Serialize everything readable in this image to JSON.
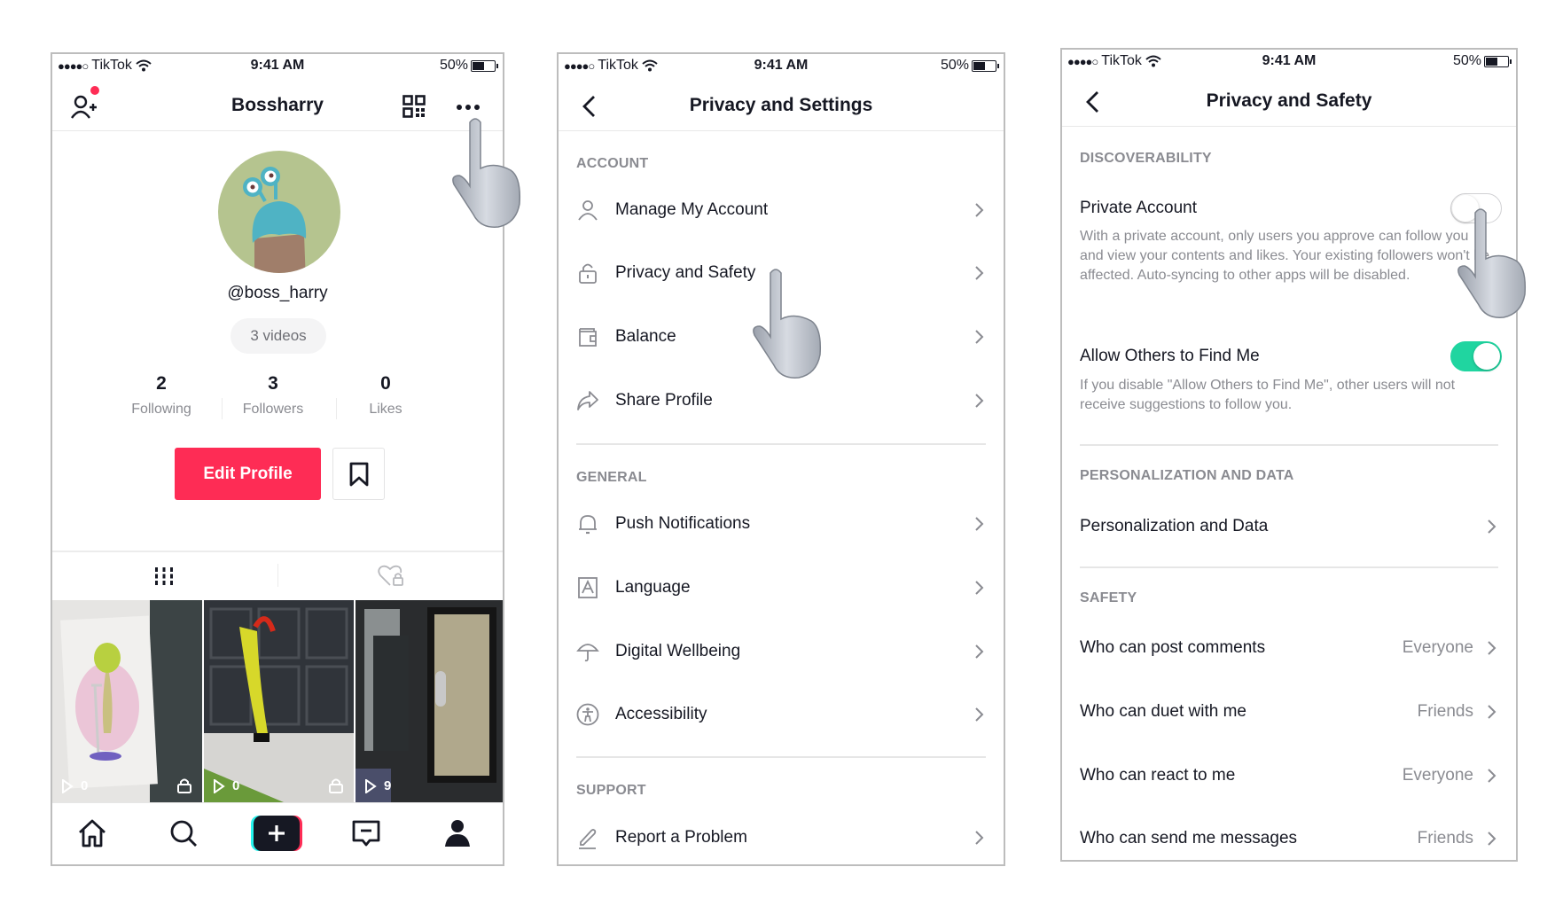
{
  "status_bar": {
    "signal_dots": "●●●●○",
    "carrier": "TikTok",
    "time": "9:41 AM",
    "battery_percent_label": "50%",
    "battery_level": 0.5
  },
  "profile_screen": {
    "title": "Bossharry",
    "has_notification_dot": true,
    "notification_color": "#fe2c55",
    "username": "@boss_harry",
    "videos_pill": "3 videos",
    "stats": [
      {
        "value": "2",
        "label": "Following"
      },
      {
        "value": "3",
        "label": "Followers"
      },
      {
        "value": "0",
        "label": "Likes"
      }
    ],
    "edit_profile_label": "Edit Profile",
    "accent_color": "#fe2c55",
    "tabs": [
      {
        "icon": "grid-icon",
        "active": true
      },
      {
        "icon": "liked-private-icon",
        "active": false
      }
    ],
    "videos": [
      {
        "views": "0",
        "private": true,
        "subject": "alien on scooter"
      },
      {
        "views": "0",
        "private": true,
        "subject": "inflatable tube man"
      },
      {
        "views": "9",
        "private": false,
        "subject": "person at glass door"
      }
    ],
    "bottom_nav": [
      "home-icon",
      "discover-icon",
      "create-icon",
      "inbox-icon",
      "profile-icon"
    ]
  },
  "settings_screen": {
    "title": "Privacy and Settings",
    "sections": [
      {
        "header": "ACCOUNT",
        "items": [
          {
            "label": "Manage My Account",
            "icon": "person-icon"
          },
          {
            "label": "Privacy and Safety",
            "icon": "lock-icon"
          },
          {
            "label": "Balance",
            "icon": "wallet-icon"
          },
          {
            "label": "Share Profile",
            "icon": "share-icon"
          }
        ]
      },
      {
        "header": "GENERAL",
        "items": [
          {
            "label": "Push Notifications",
            "icon": "bell-icon"
          },
          {
            "label": "Language",
            "icon": "language-icon"
          },
          {
            "label": "Digital Wellbeing",
            "icon": "umbrella-icon"
          },
          {
            "label": "Accessibility",
            "icon": "accessibility-icon"
          }
        ]
      },
      {
        "header": "SUPPORT",
        "items": [
          {
            "label": "Report a Problem",
            "icon": "pencil-icon"
          }
        ]
      }
    ]
  },
  "privacy_screen": {
    "title": "Privacy and Safety",
    "discoverability": {
      "header": "DISCOVERABILITY",
      "private_account": {
        "label": "Private Account",
        "enabled": false,
        "description": "With a private account, only users you approve can follow you and view your contents and likes. Your existing followers won't be affected. Auto-syncing to other apps will be disabled."
      },
      "allow_find": {
        "label": "Allow Others to Find Me",
        "enabled": true,
        "description": "If you disable \"Allow Others to Find Me\", other users will not receive suggestions to follow you."
      },
      "toggle_on_color": "#20d5a0"
    },
    "personalization": {
      "header": "PERSONALIZATION AND DATA",
      "item": "Personalization and Data"
    },
    "safety": {
      "header": "SAFETY",
      "items": [
        {
          "label": "Who can post comments",
          "value": "Everyone"
        },
        {
          "label": "Who can duet with me",
          "value": "Friends"
        },
        {
          "label": "Who can react to me",
          "value": "Everyone"
        },
        {
          "label": "Who can send me messages",
          "value": "Friends"
        }
      ]
    }
  }
}
